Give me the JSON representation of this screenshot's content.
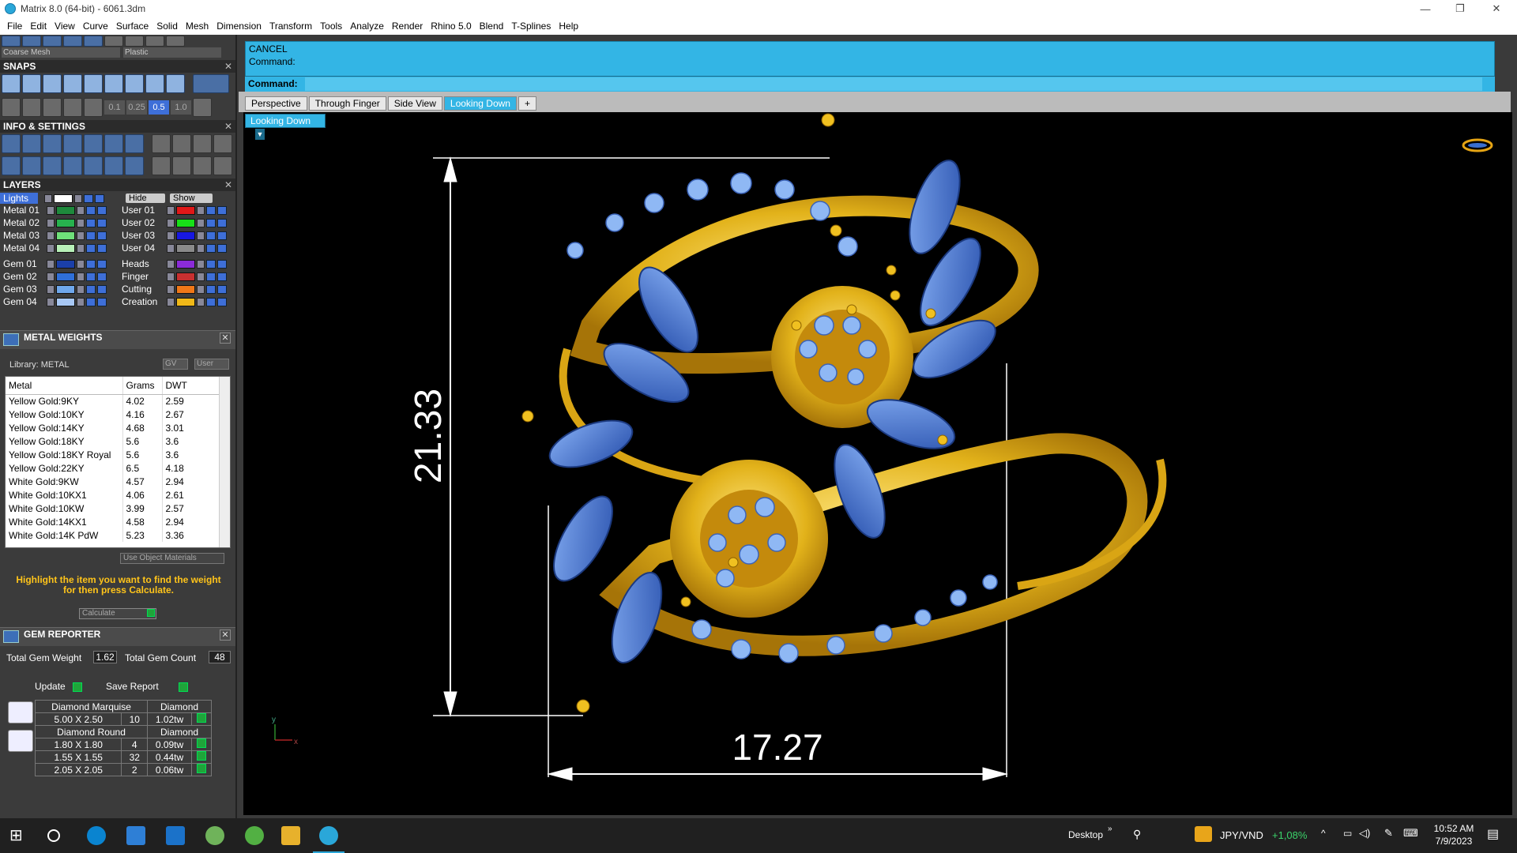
{
  "window": {
    "title": "Matrix 8.0 (64-bit) - 6061.3dm"
  },
  "menu": [
    "File",
    "Edit",
    "View",
    "Curve",
    "Surface",
    "Solid",
    "Mesh",
    "Dimension",
    "Transform",
    "Tools",
    "Analyze",
    "Render",
    "Rhino 5.0",
    "Blend",
    "T-Splines",
    "Help"
  ],
  "toolbar_top": {
    "mesh_select": "Coarse Mesh",
    "material_select": "Plastic"
  },
  "snaps": {
    "title": "SNAPS",
    "values": [
      "0.1",
      "0.25",
      "0.5",
      "1.0"
    ]
  },
  "info": {
    "title": "INFO & SETTINGS"
  },
  "layers": {
    "title": "LAYERS",
    "lights_label": "Lights",
    "hide_label": "Hide",
    "show_label": "Show",
    "left": [
      {
        "name": "Metal 01",
        "color": "#1e8a3c"
      },
      {
        "name": "Metal 02",
        "color": "#27b24e"
      },
      {
        "name": "Metal 03",
        "color": "#6fe07a"
      },
      {
        "name": "Metal 04",
        "color": "#b8f0b8"
      },
      {
        "name": "Gem 01",
        "color": "#1b3fa8"
      },
      {
        "name": "Gem 02",
        "color": "#2f6fd8"
      },
      {
        "name": "Gem 03",
        "color": "#6fa8ec"
      },
      {
        "name": "Gem 04",
        "color": "#a8c8f4"
      }
    ],
    "right": [
      {
        "name": "User 01",
        "color": "#e01818"
      },
      {
        "name": "User 02",
        "color": "#18e018"
      },
      {
        "name": "User 03",
        "color": "#1818e0"
      },
      {
        "name": "User 04",
        "color": "#8a8a8a"
      },
      {
        "name": "Heads",
        "color": "#8b2bd8"
      },
      {
        "name": "Finger",
        "color": "#c83030"
      },
      {
        "name": "Cutting",
        "color": "#f07818"
      },
      {
        "name": "Creation",
        "color": "#f0b818"
      }
    ]
  },
  "metal_weights": {
    "title": "METAL WEIGHTS",
    "library": "Library: METAL",
    "gv_label": "GV",
    "user_label": "User",
    "columns": [
      "Metal",
      "Grams",
      "DWT"
    ],
    "rows": [
      [
        "Yellow Gold:9KY",
        "4.02",
        "2.59"
      ],
      [
        "Yellow Gold:10KY",
        "4.16",
        "2.67"
      ],
      [
        "Yellow Gold:14KY",
        "4.68",
        "3.01"
      ],
      [
        "Yellow Gold:18KY",
        "5.6",
        "3.6"
      ],
      [
        "Yellow Gold:18KY Royal",
        "5.6",
        "3.6"
      ],
      [
        "Yellow Gold:22KY",
        "6.5",
        "4.18"
      ],
      [
        "White Gold:9KW",
        "4.57",
        "2.94"
      ],
      [
        "White Gold:10KX1",
        "4.06",
        "2.61"
      ],
      [
        "White Gold:10KW",
        "3.99",
        "2.57"
      ],
      [
        "White Gold:14KX1",
        "4.58",
        "2.94"
      ],
      [
        "White Gold:14K PdW",
        "5.23",
        "3.36"
      ]
    ],
    "use_object_materials": "Use Object Materials",
    "hint": "Highlight the item you want to find the weight for then press Calculate.",
    "calculate": "Calculate"
  },
  "gem_reporter": {
    "title": "GEM REPORTER",
    "total_weight_label": "Total Gem Weight",
    "total_weight": "1.62",
    "total_count_label": "Total Gem Count",
    "total_count": "48",
    "update": "Update",
    "save_report": "Save Report",
    "groups": [
      {
        "shape": "Diamond Marquise",
        "material": "Diamond",
        "rows": [
          [
            "5.00 X 2.50",
            "10",
            "1.02tw"
          ]
        ]
      },
      {
        "shape": "Diamond Round",
        "material": "Diamond",
        "rows": [
          [
            "1.80 X 1.80",
            "4",
            "0.09tw"
          ],
          [
            "1.55 X 1.55",
            "32",
            "0.44tw"
          ],
          [
            "2.05 X 2.05",
            "2",
            "0.06tw"
          ]
        ]
      }
    ]
  },
  "command": {
    "line1": "CANCEL",
    "line2": "Command:",
    "prompt": "Command:"
  },
  "view_tabs": [
    "Perspective",
    "Through Finger",
    "Side View",
    "Looking Down"
  ],
  "active_tab": "Looking Down",
  "viewport_label": "Looking Down",
  "dimensions": {
    "height": "21.33",
    "width": "17.27"
  },
  "axis": {
    "x": "x",
    "y": "y"
  },
  "taskbar": {
    "desktop": "Desktop",
    "currency": "JPY/VND",
    "change": "+1,08%",
    "time": "10:52 AM",
    "date": "7/9/2023"
  }
}
